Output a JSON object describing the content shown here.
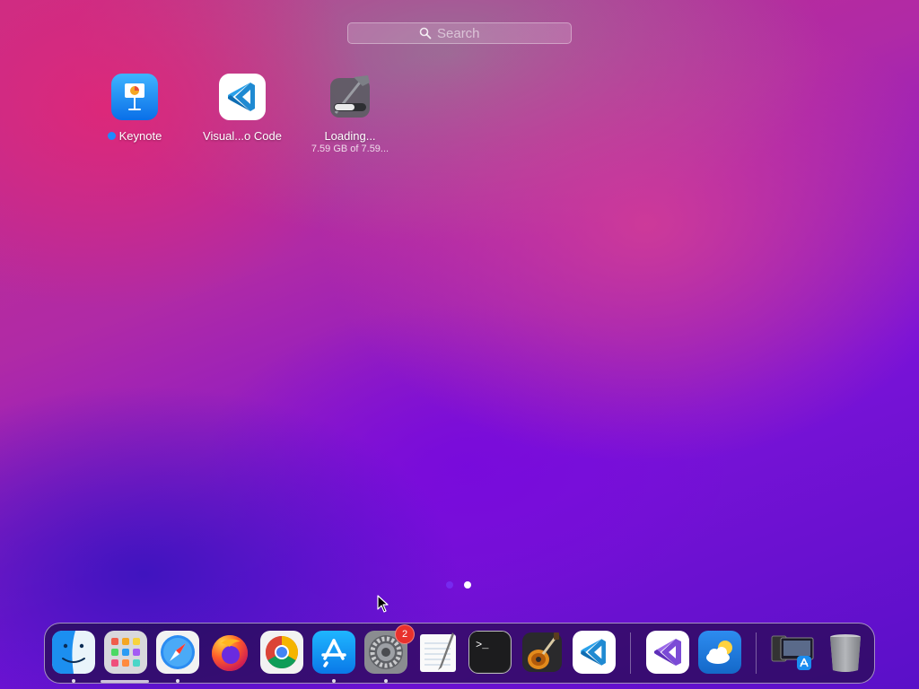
{
  "search": {
    "placeholder": "Search",
    "icon": "search-icon"
  },
  "apps": [
    {
      "label": "Keynote",
      "icon": "keynote-icon",
      "has_new_dot": true
    },
    {
      "label": "Visual...o Code",
      "icon": "vscode-icon"
    },
    {
      "label": "Loading...",
      "sublabel": "7.59 GB of 7.59...",
      "icon": "xcode-installing-icon",
      "progress": 1.0
    }
  ],
  "pages": {
    "count": 2,
    "current": 2
  },
  "dock": {
    "items": [
      {
        "name": "finder",
        "icon": "finder-icon",
        "running": true
      },
      {
        "name": "launchpad",
        "icon": "launchpad-icon",
        "running": true
      },
      {
        "name": "safari",
        "icon": "safari-icon",
        "running": true
      },
      {
        "name": "firefox",
        "icon": "firefox-icon",
        "running": false
      },
      {
        "name": "chrome",
        "icon": "chrome-icon",
        "running": false
      },
      {
        "name": "app-store",
        "icon": "app-store-icon",
        "running": true
      },
      {
        "name": "system-preferences",
        "icon": "gear-icon",
        "running": true,
        "badge": "2"
      },
      {
        "name": "textedit",
        "icon": "textedit-icon",
        "running": false
      },
      {
        "name": "terminal",
        "icon": "terminal-icon",
        "running": false
      },
      {
        "name": "garageband",
        "icon": "guitar-icon",
        "running": false
      },
      {
        "name": "vscode",
        "icon": "vscode-icon",
        "running": false
      },
      {
        "name": "visual-studio",
        "icon": "visual-studio-icon",
        "running": false
      },
      {
        "name": "weather",
        "icon": "weather-icon",
        "running": false
      },
      {
        "name": "downloads-stack",
        "icon": "stack-icon",
        "running": false
      },
      {
        "name": "trash",
        "icon": "trash-icon",
        "running": false
      }
    ]
  },
  "colors": {
    "accent_blue": "#1c8bff",
    "badge_red": "#e8312c",
    "wallpaper_pink": "#c92e86",
    "wallpaper_purple": "#7a12d8"
  }
}
